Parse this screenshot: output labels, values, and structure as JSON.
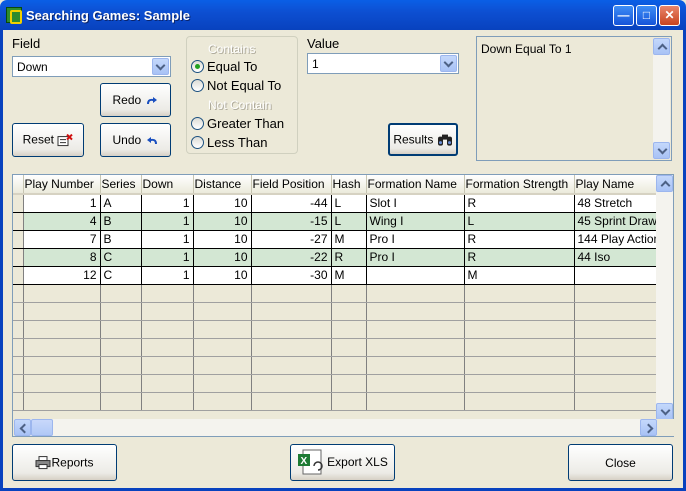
{
  "window": {
    "title": "Searching Games: Sample"
  },
  "field": {
    "label": "Field",
    "selected": "Down"
  },
  "condition_group": {
    "contains_label": "Contains",
    "not_contain_label": "Not Contain",
    "options": [
      "Equal To",
      "Not Equal To",
      "Greater Than",
      "Less Than"
    ],
    "selected": "Equal To"
  },
  "value": {
    "label": "Value",
    "selected": "1"
  },
  "criteria_text": "Down Equal To 1",
  "buttons": {
    "redo": "Redo",
    "undo": "Undo",
    "reset": "Reset",
    "results": "Results",
    "reports": "Reports",
    "export": "Export XLS",
    "close": "Close"
  },
  "grid": {
    "columns": [
      "Play Number",
      "Series",
      "Down",
      "Distance",
      "Field Position",
      "Hash",
      "Formation Name",
      "Formation Strength",
      "Play Name"
    ],
    "rows": [
      [
        "1",
        "A",
        "1",
        "10",
        "-44",
        "L",
        "Slot I",
        "R",
        "48 Stretch"
      ],
      [
        "4",
        "B",
        "1",
        "10",
        "-15",
        "L",
        "Wing I",
        "L",
        "45 Sprint Draw"
      ],
      [
        "7",
        "B",
        "1",
        "10",
        "-27",
        "M",
        "Pro I",
        "R",
        "144 Play Action"
      ],
      [
        "8",
        "C",
        "1",
        "10",
        "-22",
        "R",
        "Pro I",
        "R",
        "44 Iso"
      ],
      [
        "12",
        "C",
        "1",
        "10",
        "-30",
        "M",
        "",
        "M",
        ""
      ]
    ],
    "row_colors": [
      "#FFFFFF",
      "#D3E7D3"
    ]
  }
}
